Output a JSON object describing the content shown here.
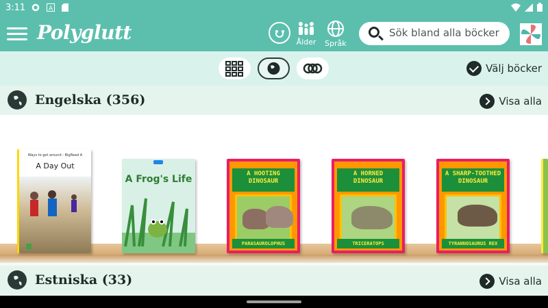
{
  "status_bar": {
    "time": "3:11",
    "left_icons": [
      "gear-icon",
      "a-icon",
      "sdcard-icon"
    ],
    "right_icons": [
      "wifi-icon",
      "signal-icon",
      "battery-icon"
    ]
  },
  "app_bar": {
    "brand": "Polyglutt",
    "age_label": "Ålder",
    "language_label": "Språk",
    "search_placeholder": "Sök bland alla böcker",
    "colors": {
      "primary": "#5cbfae",
      "dark": "#1f2b28"
    }
  },
  "filter_bar": {
    "modes": [
      "grid",
      "language",
      "rings"
    ],
    "active_mode": "language",
    "select_books_label": "Välj böcker"
  },
  "sections": [
    {
      "title": "Engelska (356)",
      "show_all_label": "Visa alla",
      "books": [
        {
          "title": "A Day Out",
          "series": "Ways to get around - BigRead A"
        },
        {
          "title": "A Frog's Life"
        },
        {
          "title": "A HOOTING DINOSAUR",
          "caption": "PARASAUROLOPHUS"
        },
        {
          "title": "A HORNED DINOSAUR",
          "caption": "TRICERATOPS"
        },
        {
          "title": "A SHARP-TOOTHED DINOSAUR",
          "caption": "TYRANNOSAURUS REX"
        }
      ]
    },
    {
      "title": "Estniska (33)",
      "show_all_label": "Visa alla"
    }
  ]
}
